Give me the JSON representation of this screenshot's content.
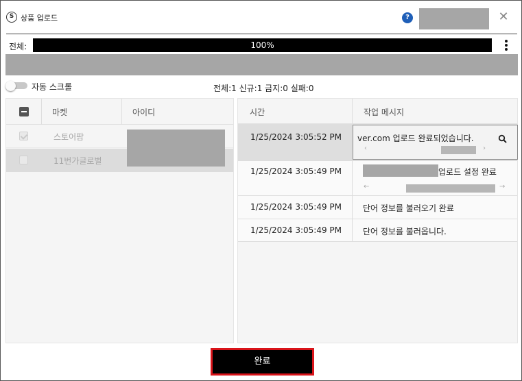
{
  "window": {
    "title": "상품 업로드",
    "app_icon": "S"
  },
  "icons": {
    "help": "help-icon",
    "close": "close-icon",
    "menu": "kebab-menu-icon",
    "search": "search-icon"
  },
  "progress": {
    "label": "전체:",
    "value": 1.0,
    "text": "100%"
  },
  "toolbar": {
    "auto_scroll_label": "자동 스크롤",
    "auto_scroll_on": false
  },
  "stats": {
    "text": "전체:1 신규:1 금지:0 실패:0"
  },
  "market_table": {
    "columns": [
      "마켓",
      "아이디"
    ],
    "rows": [
      {
        "market": "스토어팜",
        "checked": true
      },
      {
        "market": "11번가글로벌",
        "checked": false
      }
    ]
  },
  "log_table": {
    "columns": [
      "시간",
      "작업 메시지"
    ],
    "rows": [
      {
        "time": "1/25/2024 3:05:52 PM",
        "message": "ver.com 업로드 완료되었습니다."
      },
      {
        "time": "1/25/2024 3:05:49 PM",
        "message": "업로드 설정 완료"
      },
      {
        "time": "1/25/2024 3:05:49 PM",
        "message": "단어 정보를 불러오기 완료"
      },
      {
        "time": "1/25/2024 3:05:49 PM",
        "message": "단어 정보를 불러옵니다."
      }
    ]
  },
  "footer": {
    "done_label": "완료"
  },
  "colors": {
    "accent_border": "#d9141a",
    "help_blue": "#1f5fb8",
    "redacted": "#a6a6a6"
  }
}
